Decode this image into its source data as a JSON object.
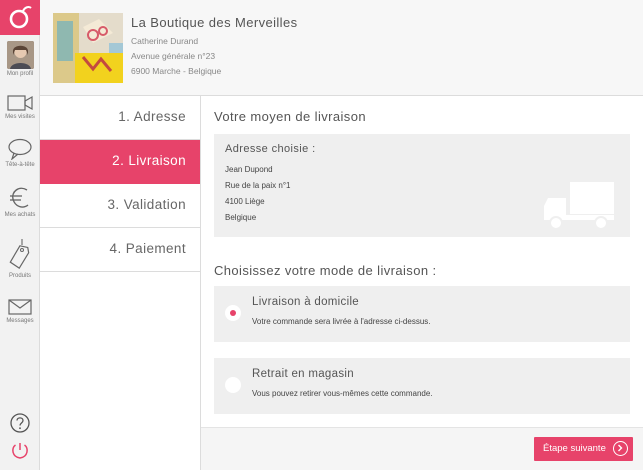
{
  "sidebar": {
    "items": [
      {
        "label": "Mon profil"
      },
      {
        "label": "Mes visites"
      },
      {
        "label": "Tête-à-tête"
      },
      {
        "label": "Mes achats"
      },
      {
        "label": "Produits"
      },
      {
        "label": "Messages"
      }
    ]
  },
  "shop": {
    "name": "La Boutique des Merveilles",
    "owner": "Catherine Durand",
    "street": "Avenue générale n°23",
    "city": "6900 Marche - Belgique"
  },
  "steps": [
    {
      "label": "1. Adresse"
    },
    {
      "label": "2. Livraison"
    },
    {
      "label": "3. Validation"
    },
    {
      "label": "4. Paiement"
    }
  ],
  "main": {
    "title": "Votre moyen de livraison",
    "address": {
      "heading": "Adresse choisie :",
      "name": "Jean Dupond",
      "street": "Rue de la paix n°1",
      "city": "4100 Liège",
      "country": "Belgique"
    },
    "mode_title": "Choisissez votre mode de livraison :",
    "options": [
      {
        "title": "Livraison à domicile",
        "desc": "Votre commande sera livrée à l'adresse ci-dessus.",
        "selected": true
      },
      {
        "title": "Retrait en magasin",
        "desc": "Vous pouvez retirer vous-mêmes cette commande.",
        "selected": false
      }
    ],
    "next_label": "Étape suivante"
  },
  "colors": {
    "accent": "#e7436a",
    "panel": "#efefef"
  },
  "icons": [
    "app-logo-icon",
    "video-icon",
    "chat-bubble-icon",
    "euro-icon",
    "tag-icon",
    "mail-icon",
    "help-icon",
    "power-icon",
    "truck-icon",
    "arrow-right-icon"
  ]
}
